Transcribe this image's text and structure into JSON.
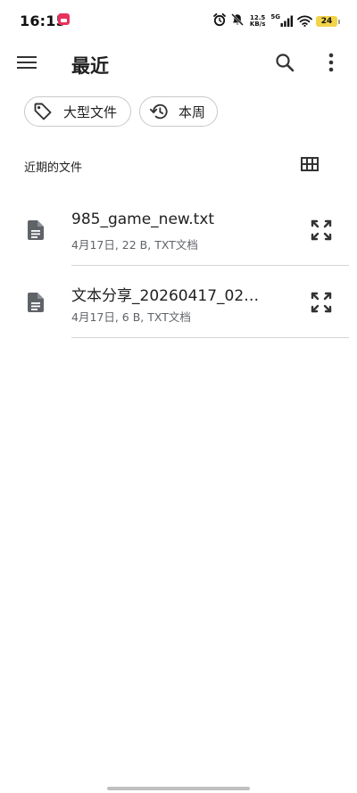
{
  "status_bar": {
    "time": "16:15",
    "net_speed_value": "12.5",
    "net_speed_unit": "KB/s",
    "network_type": "5G",
    "battery_level": "24",
    "icons": [
      "alarm-icon",
      "mute-icon",
      "signal-icon",
      "wifi-icon",
      "battery-icon"
    ],
    "battery_color": "#f2d34a",
    "app_badge_color": "#e8315b"
  },
  "app_bar": {
    "title": "最近",
    "icons": [
      "menu-icon",
      "search-icon",
      "more-vert-icon"
    ]
  },
  "filters": [
    {
      "label": "大型文件",
      "icon": "tag-icon"
    },
    {
      "label": "本周",
      "icon": "history-icon"
    }
  ],
  "section": {
    "title": "近期的文件",
    "view_toggle_icon": "grid-view-icon"
  },
  "files": [
    {
      "name": "985_game_new.txt",
      "meta": "4月17日, 22 B, TXT文档",
      "icon": "document-icon",
      "action_icon": "expand-icon"
    },
    {
      "name": "文本分享_20260417_021…",
      "meta": "4月17日, 6 B, TXT文档",
      "icon": "document-icon",
      "action_icon": "expand-icon"
    }
  ]
}
